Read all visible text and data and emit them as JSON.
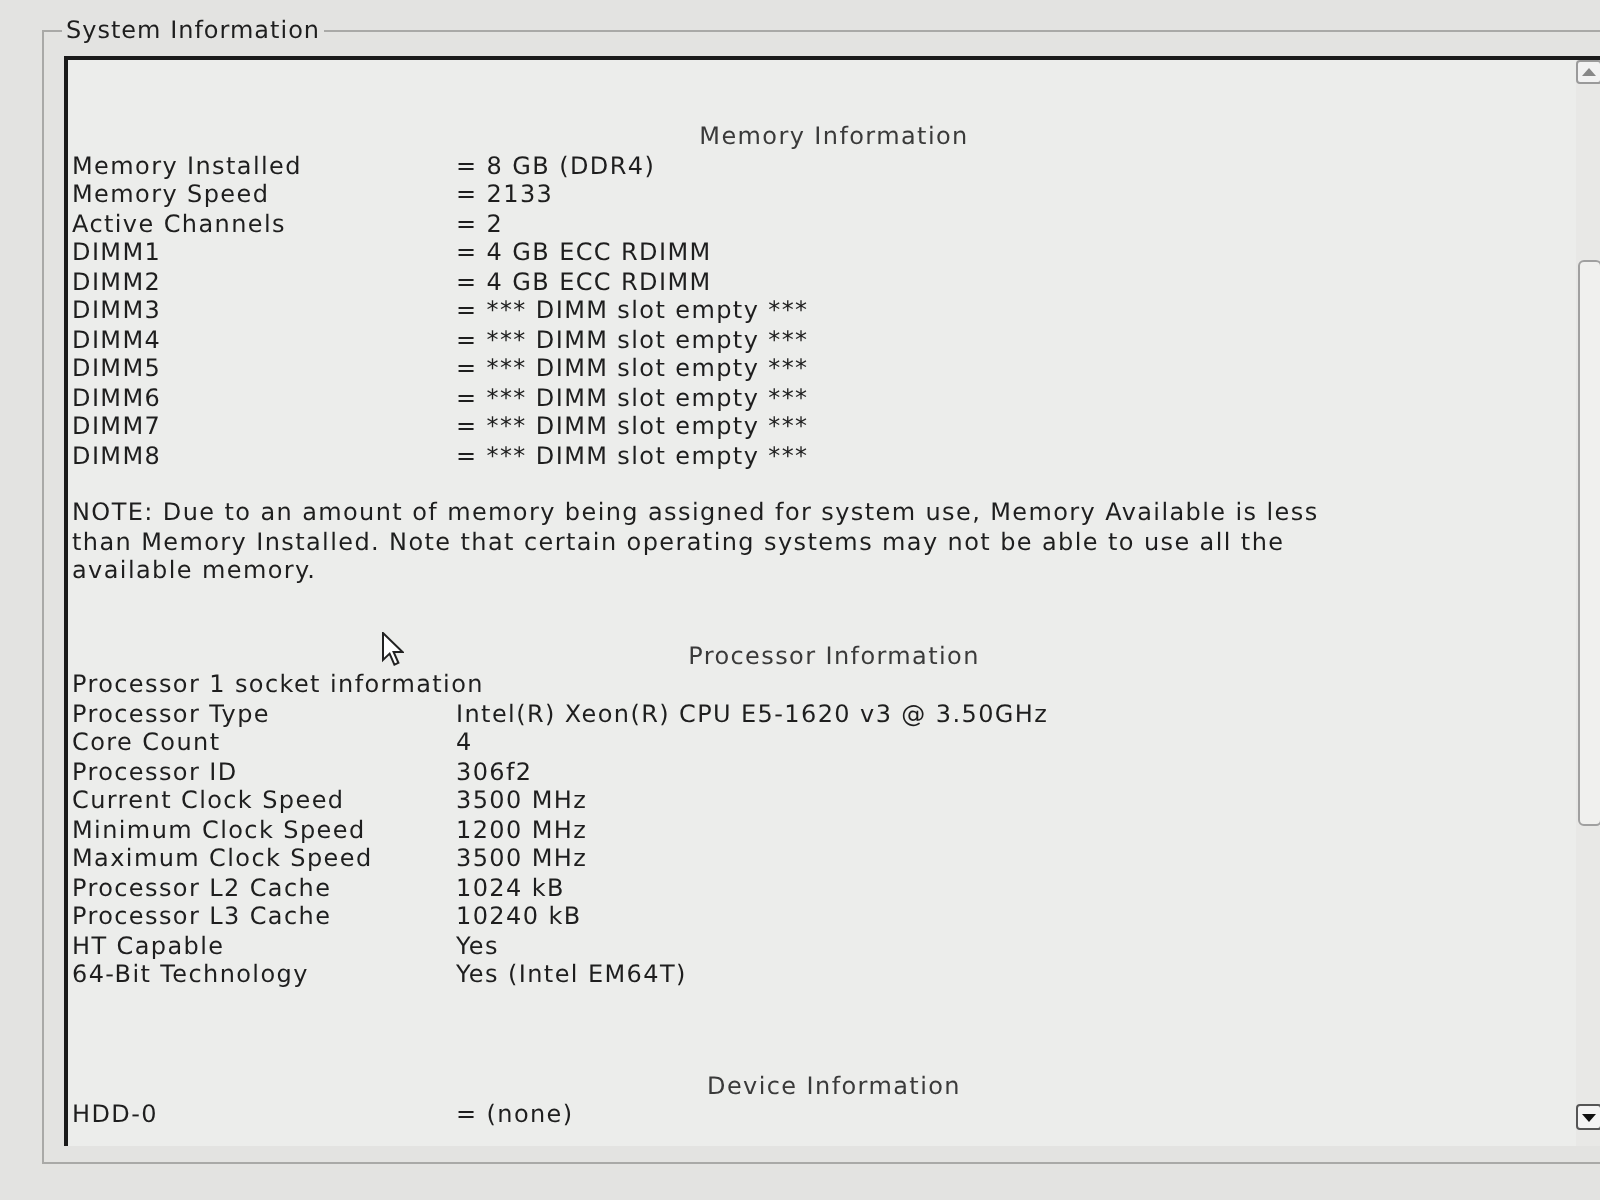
{
  "group_title": "System Information",
  "sections": [
    {
      "heading": "Memory Information",
      "rows": [
        {
          "label": "Memory Installed",
          "value": "= 8 GB (DDR4)"
        },
        {
          "label": "Memory Speed",
          "value": "= 2133"
        },
        {
          "label": "Active Channels",
          "value": "= 2"
        },
        {
          "label": "DIMM1",
          "value": "= 4 GB ECC RDIMM"
        },
        {
          "label": "DIMM2",
          "value": "= 4 GB ECC RDIMM"
        },
        {
          "label": "DIMM3",
          "value": "= *** DIMM slot empty ***"
        },
        {
          "label": "DIMM4",
          "value": "= *** DIMM slot empty ***"
        },
        {
          "label": "DIMM5",
          "value": "= *** DIMM slot empty ***"
        },
        {
          "label": "DIMM6",
          "value": "= *** DIMM slot empty ***"
        },
        {
          "label": "DIMM7",
          "value": "= *** DIMM slot empty ***"
        },
        {
          "label": "DIMM8",
          "value": "= *** DIMM slot empty ***"
        }
      ],
      "note": "NOTE: Due to an amount of memory being assigned for system use, Memory Available is less than Memory Installed. Note that certain operating systems may not be able to use all the available memory."
    },
    {
      "heading": "Processor Information",
      "rows": [
        {
          "label": "Processor 1 socket information"
        },
        {
          "label": "Processor Type",
          "value": "Intel(R) Xeon(R) CPU E5-1620 v3 @ 3.50GHz"
        },
        {
          "label": "Core Count",
          "value": "4"
        },
        {
          "label": "Processor ID",
          "value": "306f2"
        },
        {
          "label": "Current Clock Speed",
          "value": "3500 MHz"
        },
        {
          "label": "Minimum Clock Speed",
          "value": "1200 MHz"
        },
        {
          "label": "Maximum Clock Speed",
          "value": "3500 MHz"
        },
        {
          "label": "Processor L2 Cache",
          "value": "1024 kB"
        },
        {
          "label": "Processor L3 Cache",
          "value": "10240 kB"
        },
        {
          "label": "HT Capable",
          "value": "Yes"
        },
        {
          "label": "64-Bit Technology",
          "value": "Yes (Intel EM64T)"
        }
      ]
    },
    {
      "heading": "Device Information",
      "rows": [
        {
          "label": "HDD-0",
          "value": "= (none)"
        }
      ]
    }
  ]
}
